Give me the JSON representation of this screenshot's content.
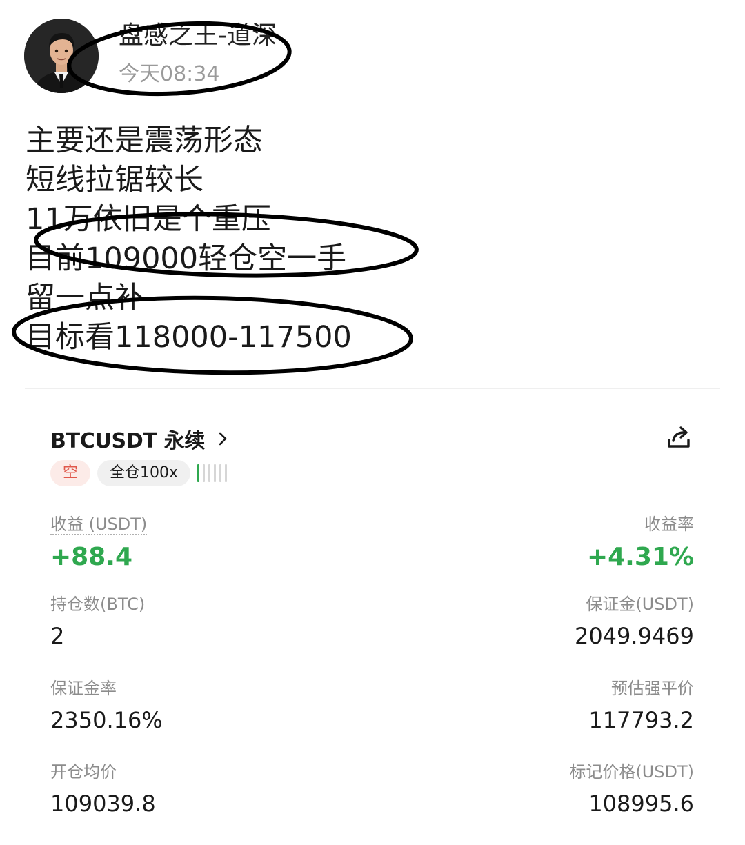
{
  "post": {
    "username": "盘感之王-道深",
    "time": "今天08:34",
    "lines": [
      "主要还是震荡形态",
      "短线拉锯较长",
      "11万依旧是个重压",
      "目前109000轻仓空一手",
      "留一点补",
      "目标看118000-117500"
    ]
  },
  "position": {
    "symbol": "BTCUSDT 永续",
    "side": "空",
    "margin_mode": "全仓100x",
    "risk_level": 1,
    "risk_max": 6,
    "pnl_label": "收益 (USDT)",
    "pnl_value": "+88.4",
    "roe_label": "收益率",
    "roe_value": "+4.31%",
    "size_label": "持仓数(BTC)",
    "size_value": "2",
    "margin_label": "保证金(USDT)",
    "margin_value": "2049.9469",
    "margin_ratio_label": "保证金率",
    "margin_ratio_value": "2350.16%",
    "liq_label": "预估强平价",
    "liq_value": "117793.2",
    "entry_label": "开仓均价",
    "entry_value": "109039.8",
    "mark_label": "标记价格(USDT)",
    "mark_value": "108995.6"
  },
  "colors": {
    "profit_green": "#2fa84f",
    "short_red": "#e0584b",
    "muted_text": "#8c8c8c"
  },
  "icons": {
    "avatar": "user-avatar-portrait",
    "chevron": "chevron-right-icon",
    "share": "share-icon"
  }
}
